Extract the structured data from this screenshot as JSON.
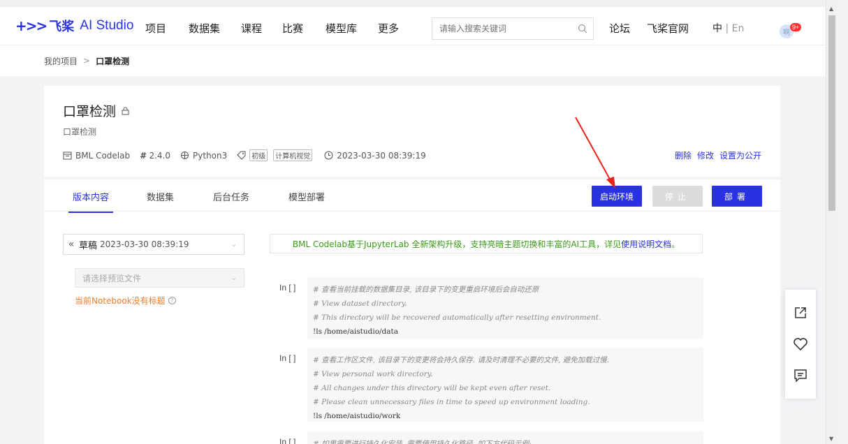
{
  "nav": {
    "logo_mark": "+>>",
    "logo_cn": "飞桨",
    "logo_en": "AI Studio",
    "items": [
      "项目",
      "数据集",
      "课程",
      "比赛",
      "模型库",
      "更多"
    ],
    "search_placeholder": "请输入搜索关键词",
    "forum": "论坛",
    "official": "飞桨官网",
    "lang_zh": "中",
    "lang_sep": "|",
    "lang_en": "En",
    "avatar": "啊",
    "badge": "9+"
  },
  "breadcrumb": {
    "parent": "我的项目",
    "sep": ">",
    "current": "口罩检测"
  },
  "project": {
    "title": "口罩检测",
    "subtitle": "口罩检测",
    "env": "BML Codelab",
    "version": "2.4.0",
    "lang": "Python3",
    "tags": [
      "初级",
      "计算机视觉"
    ],
    "date": "2023-03-30 08:39:19",
    "actions": [
      "删除",
      "修改",
      "设置为公开"
    ]
  },
  "tabs": [
    "版本内容",
    "数据集",
    "后台任务",
    "模型部署"
  ],
  "buttons": {
    "start": "启动环境",
    "stop": "停止",
    "deploy": "部署"
  },
  "left": {
    "collapse": "«",
    "draft_label": "草稿",
    "draft_date": "2023-03-30 08:39:19",
    "file_placeholder": "请选择预览文件",
    "no_title": "当前Notebook没有标题",
    "help": "?"
  },
  "notice": {
    "text": "BML Codelab基于JupyterLab 全新架构升级，支持亮暗主题切换和丰富的AI工具，详见",
    "link": "使用说明文档",
    "end": "。"
  },
  "cells": [
    {
      "prompt": "In [ ]",
      "lines": [
        "# 查看当前挂载的数据集目录, 该目录下的变更重启环境后会自动还原",
        "# View dataset directory.",
        "# This directory will be recovered automatically after resetting environment."
      ],
      "cmd": "!ls /home/aistudio/data"
    },
    {
      "prompt": "In [ ]",
      "lines": [
        "# 查看工作区文件, 该目录下的变更将会持久保存. 请及时清理不必要的文件, 避免加载过慢.",
        "# View personal work directory.",
        "# All changes under this directory will be kept even after reset.",
        "# Please clean unnecessary files in time to speed up environment loading."
      ],
      "cmd": "!ls /home/aistudio/work"
    },
    {
      "prompt": "In [ ]",
      "lines": [
        "# 如果需要进行持久化安装, 需要使用持久化路径, 如下方代码示例:"
      ],
      "cmd": ""
    }
  ],
  "colors": {
    "accent": "#2932e1",
    "notice": "#3a9a1a",
    "warn": "#f07d2b",
    "annotation": "#e8231a"
  }
}
